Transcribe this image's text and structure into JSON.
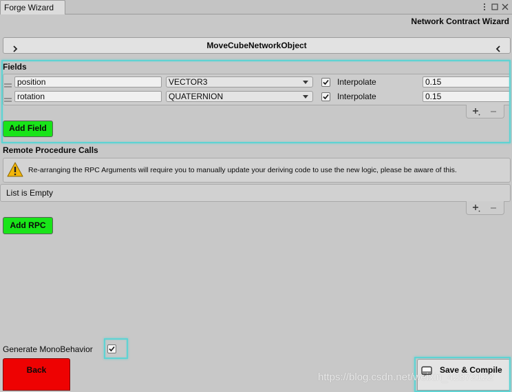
{
  "window": {
    "tab_title": "Forge Wizard",
    "icons": [
      "kebab-menu-icon",
      "maximize-icon",
      "close-icon"
    ]
  },
  "header": {
    "title": "Network Contract Wizard"
  },
  "object_bar": {
    "name": "MoveCubeNetworkObject",
    "left_icon": "chevron-right-icon",
    "right_icon": "chevron-left-icon"
  },
  "fields": {
    "heading": "Fields",
    "rows": [
      {
        "name": "position",
        "type": "VECTOR3",
        "interpolate": true,
        "interpolate_label": "Interpolate",
        "interpolate_time": "0.15"
      },
      {
        "name": "rotation",
        "type": "QUATERNION",
        "interpolate": true,
        "interpolate_label": "Interpolate",
        "interpolate_time": "0.15"
      }
    ],
    "footer_icons": [
      "add-item-icon",
      "remove-item-icon"
    ],
    "add_button": "Add Field"
  },
  "rpc": {
    "heading": "Remote Procedure Calls",
    "warning_icon": "warning-icon",
    "warning": "Re-arranging the RPC Arguments will require you to manually update your deriving code to use the new logic, please be aware of this.",
    "empty_text": "List is Empty",
    "footer_icons": [
      "add-item-icon",
      "remove-item-icon"
    ],
    "add_button": "Add RPC"
  },
  "options": {
    "generate_monobehavior_label": "Generate MonoBehavior",
    "generate_monobehavior": true
  },
  "actions": {
    "back_button": "Back",
    "save_button": "Save & Compile",
    "save_icon": "save-icon"
  },
  "watermark": "https://blog.csdn.net/weixin_42872122",
  "colors": {
    "window_background": "#c8c8c8",
    "add_button": "#19e419",
    "back_button": "#ee0202",
    "highlight": "#5fd3d3"
  }
}
